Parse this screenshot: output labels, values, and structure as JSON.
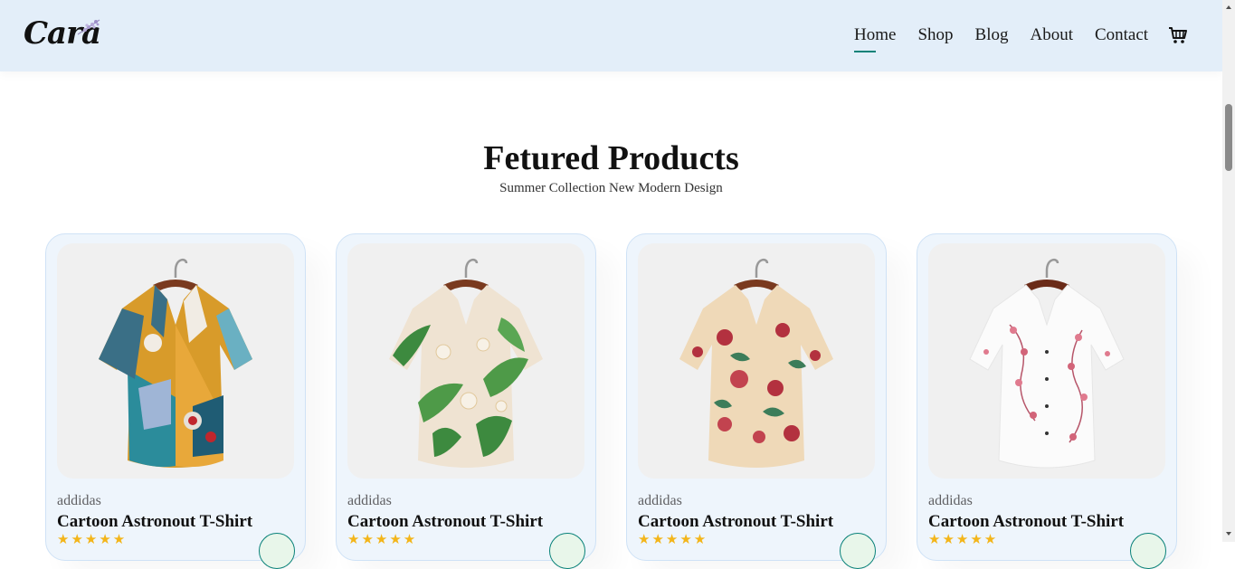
{
  "brand": {
    "logo_text": "Cara"
  },
  "nav": {
    "items": [
      {
        "label": "Home",
        "active": true
      },
      {
        "label": "Shop",
        "active": false
      },
      {
        "label": "Blog",
        "active": false
      },
      {
        "label": "About",
        "active": false
      },
      {
        "label": "Contact",
        "active": false
      }
    ],
    "cart_icon": "shopping-cart-icon"
  },
  "section": {
    "title": "Fetured Products",
    "subtitle": "Summer Collection New Modern Design"
  },
  "products": [
    {
      "brand": "addidas",
      "name": "Cartoon Astronout T-Shirt",
      "stars": "★★★★★",
      "rating": 5,
      "image": "multicolor-patterned-shirt"
    },
    {
      "brand": "addidas",
      "name": "Cartoon Astronout T-Shirt",
      "stars": "★★★★★",
      "rating": 5,
      "image": "tropical-leaf-shirt"
    },
    {
      "brand": "addidas",
      "name": "Cartoon Astronout T-Shirt",
      "stars": "★★★★★",
      "rating": 5,
      "image": "floral-rose-shirt"
    },
    {
      "brand": "addidas",
      "name": "Cartoon Astronout T-Shirt",
      "stars": "★★★★★",
      "rating": 5,
      "image": "white-blossom-shirt"
    }
  ],
  "colors": {
    "header_bg": "#e3eef9",
    "accent": "#088178",
    "star": "#f3b519",
    "card_bg": "#eef5fc"
  }
}
